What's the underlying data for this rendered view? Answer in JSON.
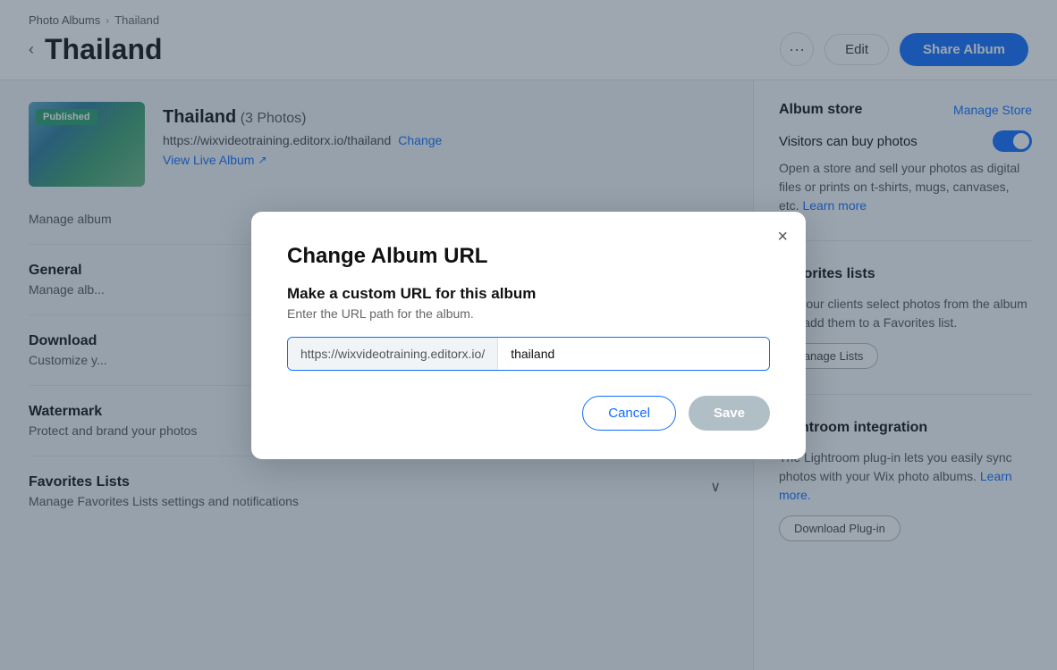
{
  "breadcrumb": {
    "parent": "Photo Albums",
    "current": "Thailand"
  },
  "header": {
    "title": "Thailand",
    "back_label": "‹",
    "more_label": "···",
    "edit_label": "Edit",
    "share_label": "Share Album"
  },
  "album": {
    "name": "Thailand",
    "count_label": "(3 Photos)",
    "url": "https://wixvideotraining.editorx.io/thailand",
    "change_label": "Change",
    "view_label": "View Live Album",
    "published_badge": "Published"
  },
  "manage_section": {
    "label": "Manage album"
  },
  "settings_sections": [
    {
      "title": "General",
      "desc": "Manage alb..."
    },
    {
      "title": "Download",
      "desc": "Customize y..."
    },
    {
      "title": "Watermark",
      "desc": "Protect and brand your photos"
    },
    {
      "title": "Favorites Lists",
      "desc": "Manage Favorites Lists settings and notifications"
    }
  ],
  "right_panel": {
    "album_store": {
      "title": "Album store",
      "manage_label": "Manage Store",
      "toggle_label": "Visitors can buy photos",
      "desc": "Open a store and sell your photos as digital files or prints on t-shirts, mugs, canvases, etc.",
      "learn_more": "Learn more"
    },
    "favorites_lists": {
      "title": "Favorites lists",
      "desc": "Let your clients select photos from the album and add them to a Favorites list.",
      "manage_label": "Manage Lists"
    },
    "lightroom": {
      "title": "Lightroom integration",
      "desc": "The Lightroom plug-in lets you easily sync photos with your Wix photo albums.",
      "learn_more": "Learn more.",
      "download_label": "Download Plug-in"
    }
  },
  "modal": {
    "title": "Change Album URL",
    "subtitle": "Make a custom URL for this album",
    "desc": "Enter the URL path for the album.",
    "url_prefix": "https://wixvideotraining.editorx.io/",
    "url_value": "thailand",
    "cancel_label": "Cancel",
    "save_label": "Save",
    "close_label": "×"
  }
}
